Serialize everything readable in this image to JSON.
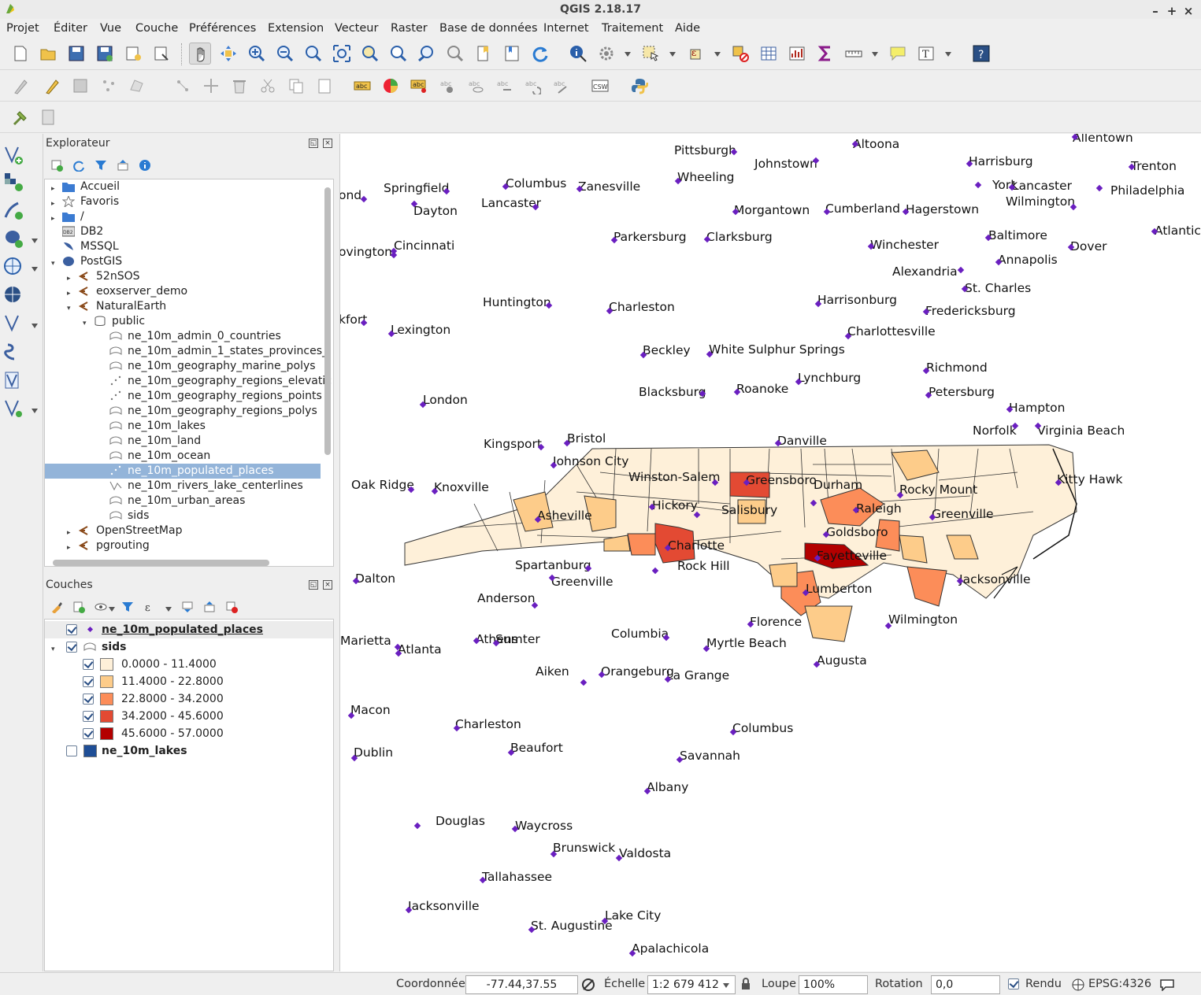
{
  "window": {
    "title": "QGIS 2.18.17",
    "controls": [
      "–",
      "+",
      "×"
    ]
  },
  "menu": [
    "Projet",
    "Éditer",
    "Vue",
    "Couche",
    "Préférences",
    "Extension",
    "Vecteur",
    "Raster",
    "Base de données",
    "Internet",
    "Traitement",
    "Aide"
  ],
  "browser": {
    "title": "Explorateur",
    "items": [
      {
        "label": "Accueil",
        "icon": "folder-icon"
      },
      {
        "label": "Favoris",
        "icon": "star-icon"
      },
      {
        "label": "/",
        "icon": "folder-icon"
      },
      {
        "label": "DB2",
        "icon": "db2-icon"
      },
      {
        "label": "MSSQL",
        "icon": "mssql-icon"
      },
      {
        "label": "PostGIS",
        "icon": "elephant-icon"
      },
      {
        "label": "52nSOS",
        "icon": "connection-icon"
      },
      {
        "label": "eoxserver_demo",
        "icon": "connection-icon"
      },
      {
        "label": "NaturalEarth",
        "icon": "connection-icon"
      },
      {
        "label": "public",
        "icon": "schema-icon"
      },
      {
        "label": "ne_10m_admin_0_countries",
        "icon": "polygon-layer-icon"
      },
      {
        "label": "ne_10m_admin_1_states_provinces_",
        "icon": "polygon-layer-icon"
      },
      {
        "label": "ne_10m_geography_marine_polys",
        "icon": "polygon-layer-icon"
      },
      {
        "label": "ne_10m_geography_regions_elevatic",
        "icon": "point-layer-icon"
      },
      {
        "label": "ne_10m_geography_regions_points",
        "icon": "point-layer-icon"
      },
      {
        "label": "ne_10m_geography_regions_polys",
        "icon": "polygon-layer-icon"
      },
      {
        "label": "ne_10m_lakes",
        "icon": "polygon-layer-icon"
      },
      {
        "label": "ne_10m_land",
        "icon": "polygon-layer-icon"
      },
      {
        "label": "ne_10m_ocean",
        "icon": "polygon-layer-icon"
      },
      {
        "label": "ne_10m_populated_places",
        "icon": "point-layer-icon"
      },
      {
        "label": "ne_10m_rivers_lake_centerlines",
        "icon": "line-layer-icon"
      },
      {
        "label": "ne_10m_urban_areas",
        "icon": "polygon-layer-icon"
      },
      {
        "label": "sids",
        "icon": "polygon-layer-icon"
      },
      {
        "label": "OpenStreetMap",
        "icon": "connection-icon"
      },
      {
        "label": "pgrouting",
        "icon": "connection-icon"
      }
    ]
  },
  "layers": {
    "title": "Couches",
    "items": [
      {
        "label": "ne_10m_populated_places",
        "checked": true
      },
      {
        "label": "sids",
        "checked": true
      },
      {
        "label": "ne_10m_lakes",
        "checked": false
      }
    ],
    "classes": [
      {
        "label": "0.0000 - 11.4000",
        "color": "#fef0d9"
      },
      {
        "label": "11.4000 - 22.8000",
        "color": "#fdcc8a"
      },
      {
        "label": "22.8000 - 34.2000",
        "color": "#fc8d59"
      },
      {
        "label": "34.2000 - 45.6000",
        "color": "#e34a33"
      },
      {
        "label": "45.6000 - 57.0000",
        "color": "#b30000"
      }
    ],
    "lakes_color": "#1f4e96"
  },
  "map": {
    "places": [
      "Pittsburgh",
      "Johnstown",
      "Altoona",
      "Allentown",
      "Harrisburg",
      "Trenton",
      "York",
      "Lancaster",
      "Philadelphia",
      "Wilmington",
      "Springfield",
      "Columbus",
      "Zanesville",
      "Wheeling",
      "ond",
      "Dayton",
      "Lancaster",
      "Morgantown",
      "Cumberland",
      "Hagerstown",
      "Atlantic",
      "Baltimore",
      "Dover",
      "Parkersburg",
      "Clarksburg",
      "Winchester",
      "Cincinnati",
      "ovington",
      "Annapolis",
      "Alexandria",
      "St. Charles",
      "Huntington",
      "Charleston",
      "Harrisonburg",
      "Fredericksburg",
      "kfort",
      "Lexington",
      "Charlottesville",
      "Beckley",
      "White Sulphur Springs",
      "Richmond",
      "Lynchburg",
      "Blacksburg",
      "Roanoke",
      "Petersburg",
      "London",
      "Hampton",
      "Norfolk",
      "Virginia Beach",
      "Kingsport",
      "Bristol",
      "Danville",
      "Johnson City",
      "Winston-Salem",
      "Greensboro",
      "Durham",
      "Kitty Hawk",
      "Oak Ridge",
      "Knoxville",
      "Hickory",
      "Rocky Mount",
      "Raleigh",
      "Asheville",
      "Salisbury",
      "Greenville",
      "Goldsboro",
      "Charlotte",
      "Fayetteville",
      "Spartanburg",
      "Rock Hill",
      "Jacksonville",
      "Greenville",
      "Dalton",
      "Lumberton",
      "Anderson",
      "Wilmington",
      "Florence",
      "Columbia",
      "Marietta",
      "Athens",
      "Atlanta",
      "Sumter",
      "Myrtle Beach",
      "Augusta",
      "Aiken",
      "Orangeburg",
      "La Grange",
      "Macon",
      "Charleston",
      "Columbus",
      "Dublin",
      "Beaufort",
      "Savannah",
      "Albany",
      "Douglas",
      "Waycross",
      "Brunswick",
      "Valdosta",
      "Tallahassee",
      "Jacksonville",
      "Lake City",
      "St. Augustine",
      "Apalachicola"
    ]
  },
  "status": {
    "coord_label": "Coordonnée",
    "coord_value": "-77.44,37.55",
    "scale_label": "Échelle",
    "scale_value": "1:2 679 412",
    "zoom_label": "Loupe",
    "zoom_value": "100%",
    "rotation_label": "Rotation",
    "rotation_value": "0,0",
    "render_label": "Rendu",
    "crs": "EPSG:4326"
  }
}
